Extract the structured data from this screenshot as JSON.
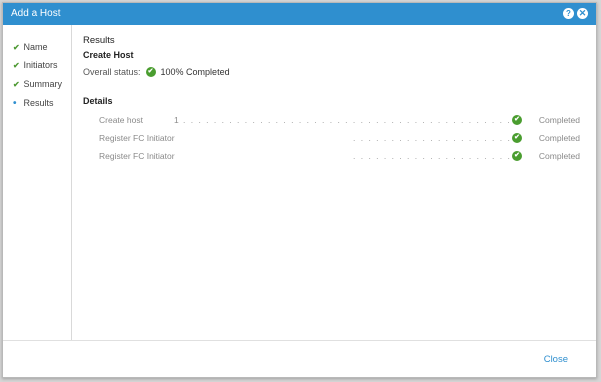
{
  "window": {
    "title": "Add a Host",
    "help_glyph": "?",
    "close_glyph": "✕"
  },
  "steps": [
    {
      "label": "Name",
      "state": "done"
    },
    {
      "label": "Initiators",
      "state": "done"
    },
    {
      "label": "Summary",
      "state": "done"
    },
    {
      "label": "Results",
      "state": "current"
    }
  ],
  "results": {
    "heading": "Results",
    "section": "Create Host",
    "overall_label": "Overall status:",
    "overall_value": "100% Completed"
  },
  "details": {
    "heading": "Details",
    "rows": [
      {
        "label": "Create host",
        "number": "1",
        "status": "Completed"
      },
      {
        "label": "Register FC Initiator",
        "number": "",
        "status": "Completed"
      },
      {
        "label": "Register FC Initiator",
        "number": "",
        "status": "Completed"
      }
    ]
  },
  "footer": {
    "close_label": "Close"
  },
  "colors": {
    "titlebar": "#2f8fcf",
    "success": "#4a9d2f",
    "link": "#2f8fcf"
  }
}
